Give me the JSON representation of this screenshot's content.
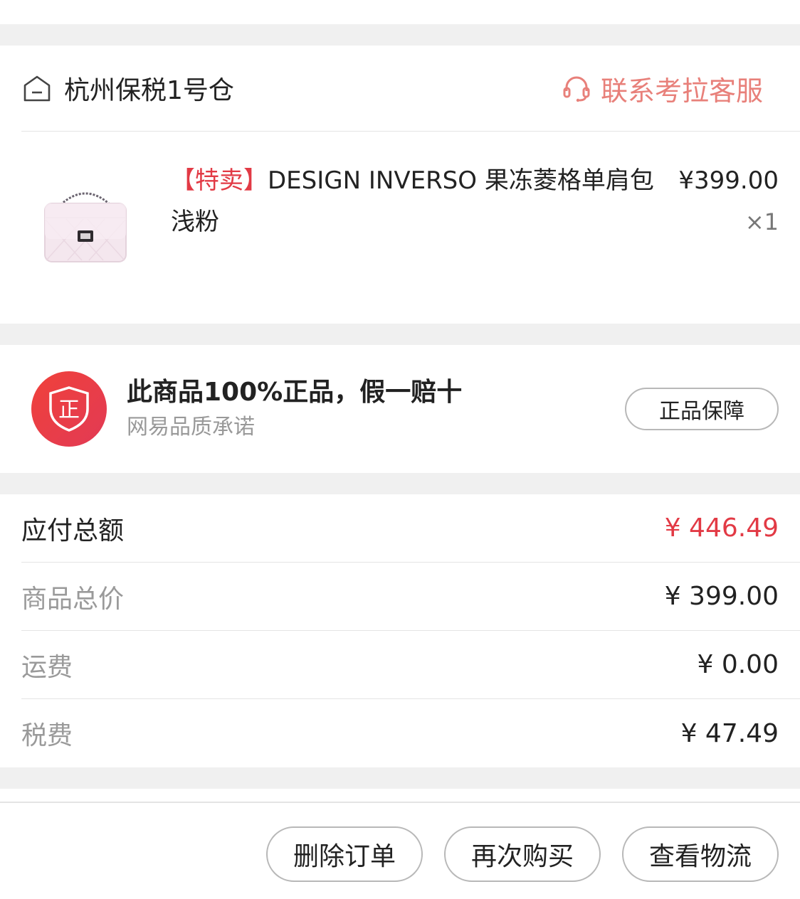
{
  "warehouse": {
    "name": "杭州保税1号仓",
    "service_label": "联系考拉客服"
  },
  "product": {
    "tag": "【特卖】",
    "title": "DESIGN INVERSO 果冻菱格单肩包 浅粉",
    "price": "¥399.00",
    "qty": "×1"
  },
  "guarantee": {
    "badge_char": "正",
    "title": "此商品100%正品，假一赔十",
    "subtitle": "网易品质承诺",
    "button": "正品保障"
  },
  "totals": {
    "payable_label": "应付总额",
    "payable_value": "¥ 446.49",
    "goods_label": "商品总价",
    "goods_value": "¥ 399.00",
    "shipping_label": "运费",
    "shipping_value": "¥ 0.00",
    "tax_label": "税费",
    "tax_value": "¥ 47.49"
  },
  "actions": {
    "delete": "删除订单",
    "rebuy": "再次购买",
    "logistics": "查看物流"
  },
  "colors": {
    "accent_red": "#e23a45",
    "service_pink": "#e8807a",
    "gap_gray": "#f0f0f0"
  }
}
